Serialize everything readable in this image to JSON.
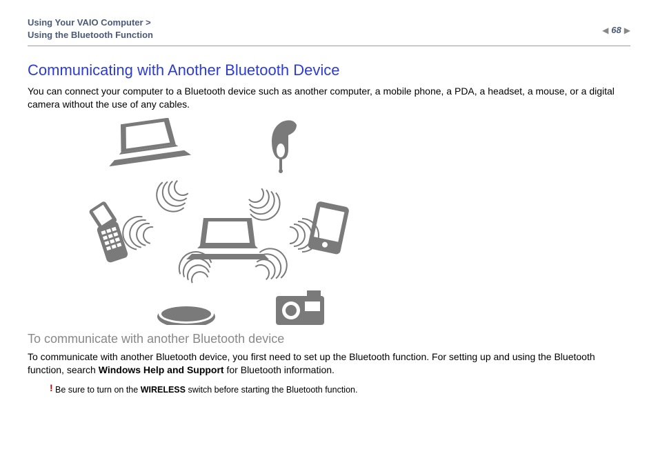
{
  "header": {
    "breadcrumb_line1": "Using Your VAIO Computer >",
    "breadcrumb_line2": "Using the Bluetooth Function",
    "page_number": "68"
  },
  "main": {
    "title": "Communicating with Another Bluetooth Device",
    "intro": "You can connect your computer to a Bluetooth device such as another computer, a mobile phone, a PDA, a headset, a mouse, or a digital camera without the use of any cables.",
    "subhead": "To communicate with another Bluetooth device",
    "para2_pre": "To communicate with another Bluetooth device, you first need to set up the Bluetooth function. For setting up and using the Bluetooth function, search ",
    "para2_bold": "Windows Help and Support",
    "para2_post": " for Bluetooth information.",
    "note_bang": "!",
    "note_pre": "Be sure to turn on the ",
    "note_bold": "WIRELESS",
    "note_post": " switch before starting the Bluetooth function."
  },
  "diagram": {
    "devices": [
      "laptop",
      "laptop-center",
      "headset",
      "pda",
      "camera",
      "mouse",
      "flip-phone"
    ]
  }
}
